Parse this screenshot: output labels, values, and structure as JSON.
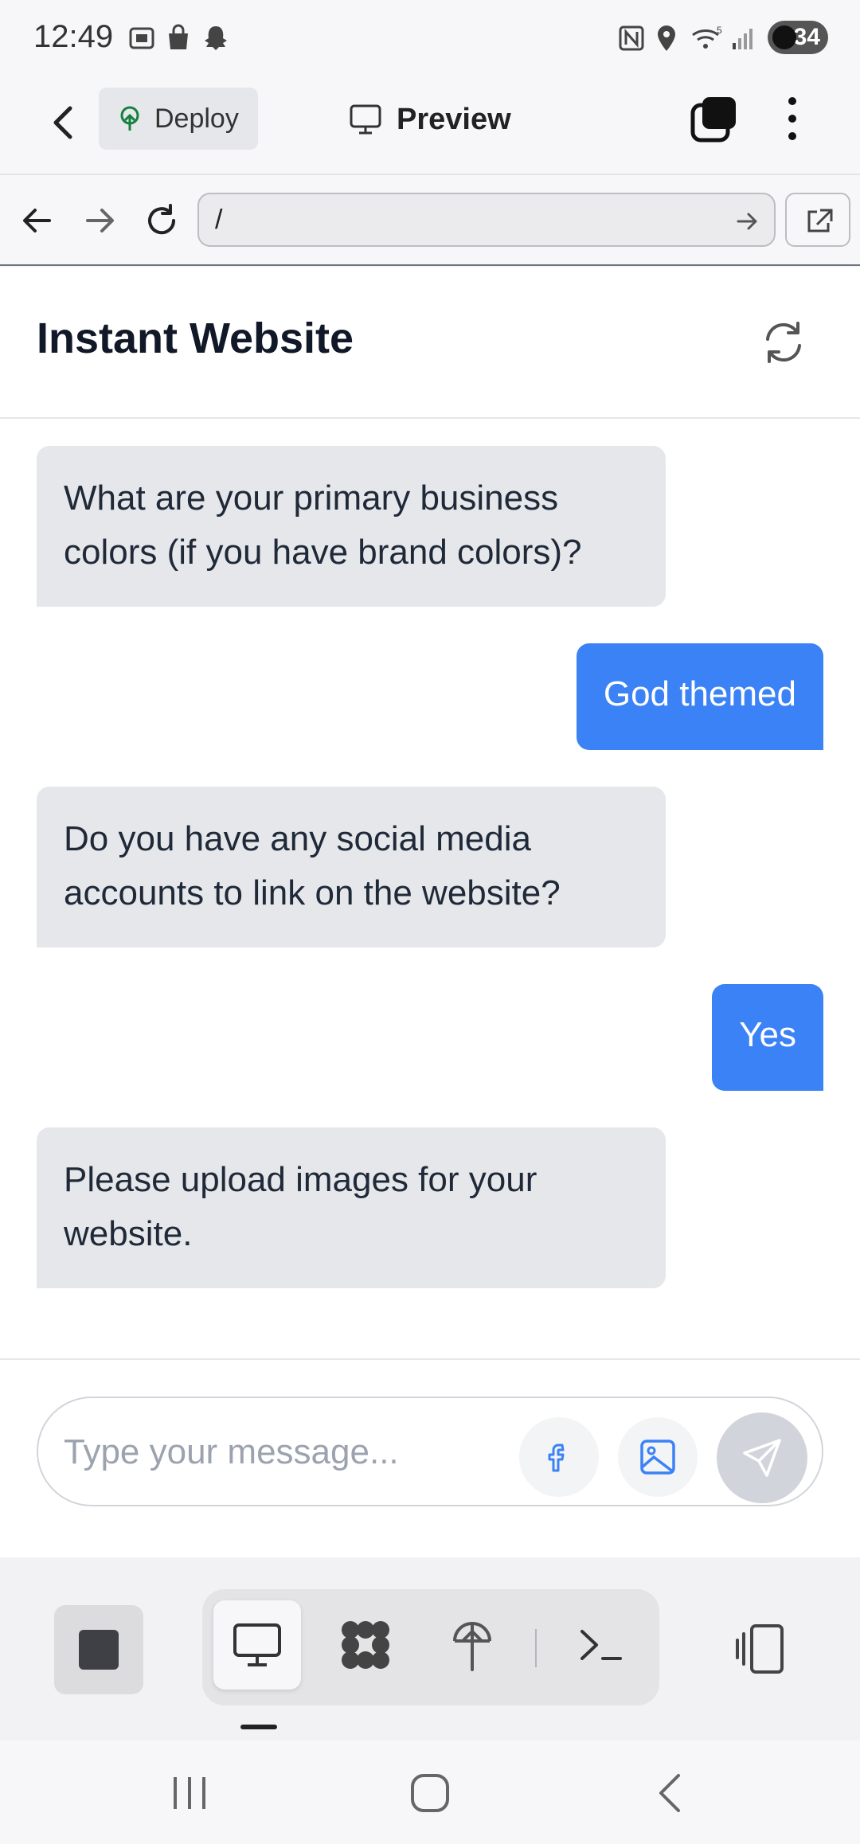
{
  "status": {
    "time": "12:49",
    "battery": "34"
  },
  "header": {
    "deploy_label": "Deploy",
    "preview_label": "Preview"
  },
  "browser": {
    "url": "/"
  },
  "page": {
    "title": "Instant Website",
    "messages": [
      {
        "role": "bot",
        "text": "What are your primary business colors (if you have brand colors)?"
      },
      {
        "role": "user",
        "text": "God themed"
      },
      {
        "role": "bot",
        "text": "Do you have any social media accounts to link on the website?"
      },
      {
        "role": "user",
        "text": "Yes"
      },
      {
        "role": "bot",
        "text": "Please upload images for your website."
      }
    ],
    "input_placeholder": "Type your message..."
  },
  "colors": {
    "user_bubble": "#3b82f6",
    "bot_bubble": "#e5e7eb",
    "accent": "#3b82f6"
  },
  "icons": [
    "back-icon",
    "deploy-icon",
    "monitor-icon",
    "tabs-icon",
    "more-icon",
    "arrow-left-icon",
    "arrow-right-icon",
    "reload-icon",
    "external-link-icon",
    "refresh-icon",
    "facebook-icon",
    "image-icon",
    "send-icon",
    "stop-icon",
    "desktop-icon",
    "apps-icon",
    "deploy-icon",
    "terminal-icon",
    "split-view-icon"
  ]
}
